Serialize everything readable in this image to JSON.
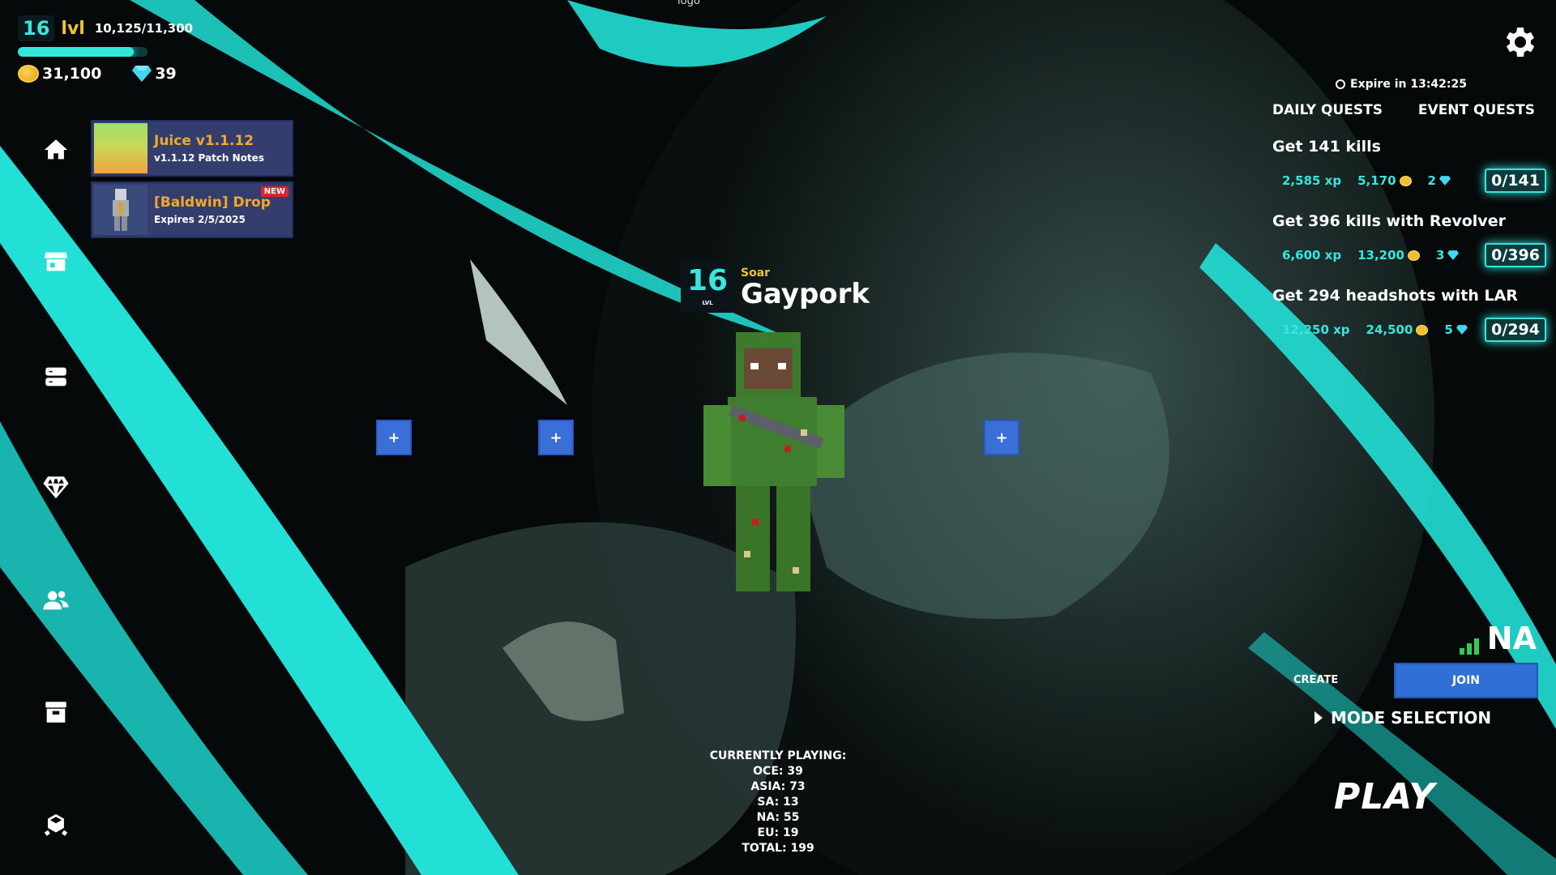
{
  "player": {
    "level": "16",
    "level_label": "lvl",
    "xp_text": "10,125/11,300",
    "xp_fraction": 0.896,
    "coins": "31,100",
    "gems": "39"
  },
  "broken_logo_alt": "logo",
  "news": [
    {
      "title": "Juice v1.1.12",
      "subtitle": "v1.1.12 Patch Notes",
      "badge": ""
    },
    {
      "title": "[Baldwin] Drop",
      "subtitle": "Expires 2/5/2025",
      "badge": "NEW"
    }
  ],
  "nav_icons": [
    "home-icon",
    "store-icon",
    "inventory-icon",
    "gem-shop-icon",
    "friends-icon",
    "crate-icon",
    "hub-icon"
  ],
  "character": {
    "level": "16",
    "level_sub": "LVL",
    "tag": "Soar",
    "name": "Gaypork"
  },
  "slot_buttons": [
    "+",
    "+",
    "+"
  ],
  "currently_playing": {
    "heading": "CURRENTLY PLAYING:",
    "lines": [
      "OCE: 39",
      "ASIA: 73",
      "SA: 13",
      "NA: 55",
      "EU: 19",
      "TOTAL: 199"
    ]
  },
  "quests": {
    "expire_text": "Expire in 13:42:25",
    "tabs": [
      "DAILY QUESTS",
      "EVENT QUESTS"
    ],
    "items": [
      {
        "title": "Get 141 kills",
        "xp": "2,585 xp",
        "coins": "5,170",
        "gems": "2",
        "progress": "0/141"
      },
      {
        "title": "Get 396 kills with Revolver",
        "xp": "6,600 xp",
        "coins": "13,200",
        "gems": "3",
        "progress": "0/396"
      },
      {
        "title": "Get 294 headshots with LAR",
        "xp": "12,250 xp",
        "coins": "24,500",
        "gems": "5",
        "progress": "0/294"
      }
    ]
  },
  "region": "NA",
  "lobby": {
    "create_label": "CREATE",
    "join_label": "JOIN",
    "mode_label": "MODE SELECTION",
    "play_label": "PLAY"
  },
  "colors": {
    "accent": "#32e6dc",
    "gold": "#f2c230",
    "button_blue": "#2f6fd6",
    "card_bg": "#333e6e"
  }
}
